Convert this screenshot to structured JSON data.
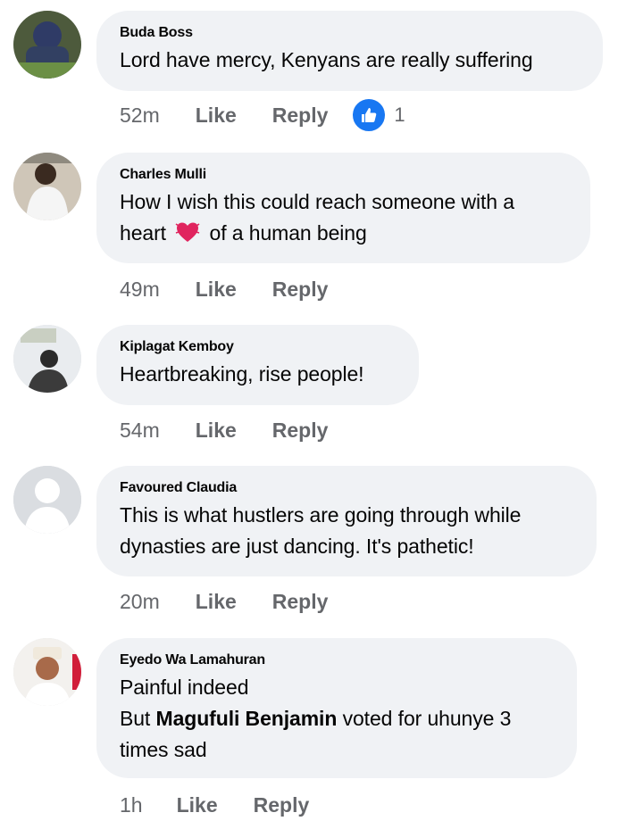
{
  "colors": {
    "bubble": "#f0f2f5",
    "meta_text": "#65676b",
    "like_blue": "#1877f2",
    "heart_red": "#e0245e"
  },
  "comments": [
    {
      "author": "Buda Boss",
      "text": "Lord have mercy, Kenyans are really suffering",
      "time": "52m",
      "like_label": "Like",
      "reply_label": "Reply",
      "reaction_icon": "thumbs-up-icon",
      "reaction_count": "1"
    },
    {
      "author": "Charles Mulli",
      "text_before_emoji": "How I wish this could reach someone with a heart",
      "emoji": "beating-heart-icon",
      "text_after_emoji": "of a human being",
      "time": "49m",
      "like_label": "Like",
      "reply_label": "Reply"
    },
    {
      "author": "Kiplagat Kemboy",
      "text": "Heartbreaking, rise people!",
      "time": "54m",
      "like_label": "Like",
      "reply_label": "Reply"
    },
    {
      "author": "Favoured Claudia",
      "text": "This is what hustlers are going through while dynasties are just dancing. It's pathetic!",
      "time": "20m",
      "like_label": "Like",
      "reply_label": "Reply"
    },
    {
      "author": "Eyedo Wa Lamahuran",
      "line1": "Painful indeed",
      "line2_before": "But",
      "mention": "Magufuli Benjamin",
      "line2_after": "voted for uhunye 3 times sad",
      "time": "1h",
      "like_label": "Like",
      "reply_label": "Reply"
    }
  ]
}
